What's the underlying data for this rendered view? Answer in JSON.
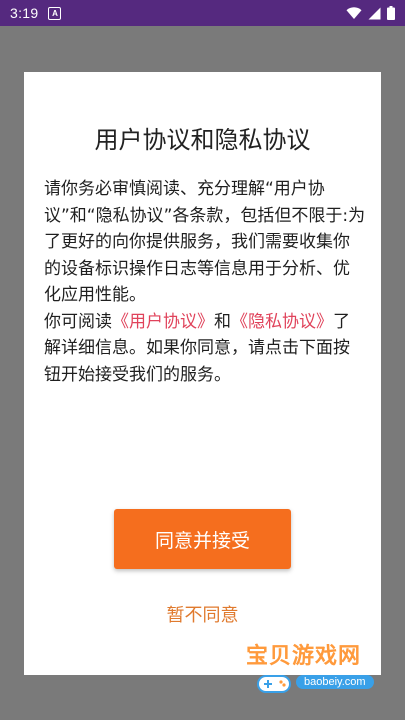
{
  "status_bar": {
    "time": "3:19",
    "notification_icon_letter": "A",
    "icons": [
      "wifi-icon",
      "signal-icon",
      "battery-icon"
    ]
  },
  "dialog": {
    "title": "用户协议和隐私协议",
    "paragraph1": "请你务必审慎阅读、充分理解“用户协议”和“隐私协议”各条款，包括但不限于:为了更好的向你提供服务，我们需要收集你的设备标识操作日志等信息用于分析、优化应用性能。",
    "paragraph2": {
      "prefix": "你可阅读",
      "link_user": "《用户协议》",
      "middle": "和",
      "link_privacy": "《隐私协议》",
      "suffix": "了解详细信息。如果你同意，请点击下面按钮开始接受我们的服务。"
    },
    "agree_label": "同意并接受",
    "decline_label": "暂不同意"
  },
  "watermark": {
    "name": "宝贝游戏网",
    "url": "baobeiy.com"
  },
  "colors": {
    "status_bar": "#55297f",
    "overlay": "#7a7a7a",
    "agree_button": "#f56e1e",
    "link": "#e0435b",
    "decline_text": "#e07a2e"
  }
}
